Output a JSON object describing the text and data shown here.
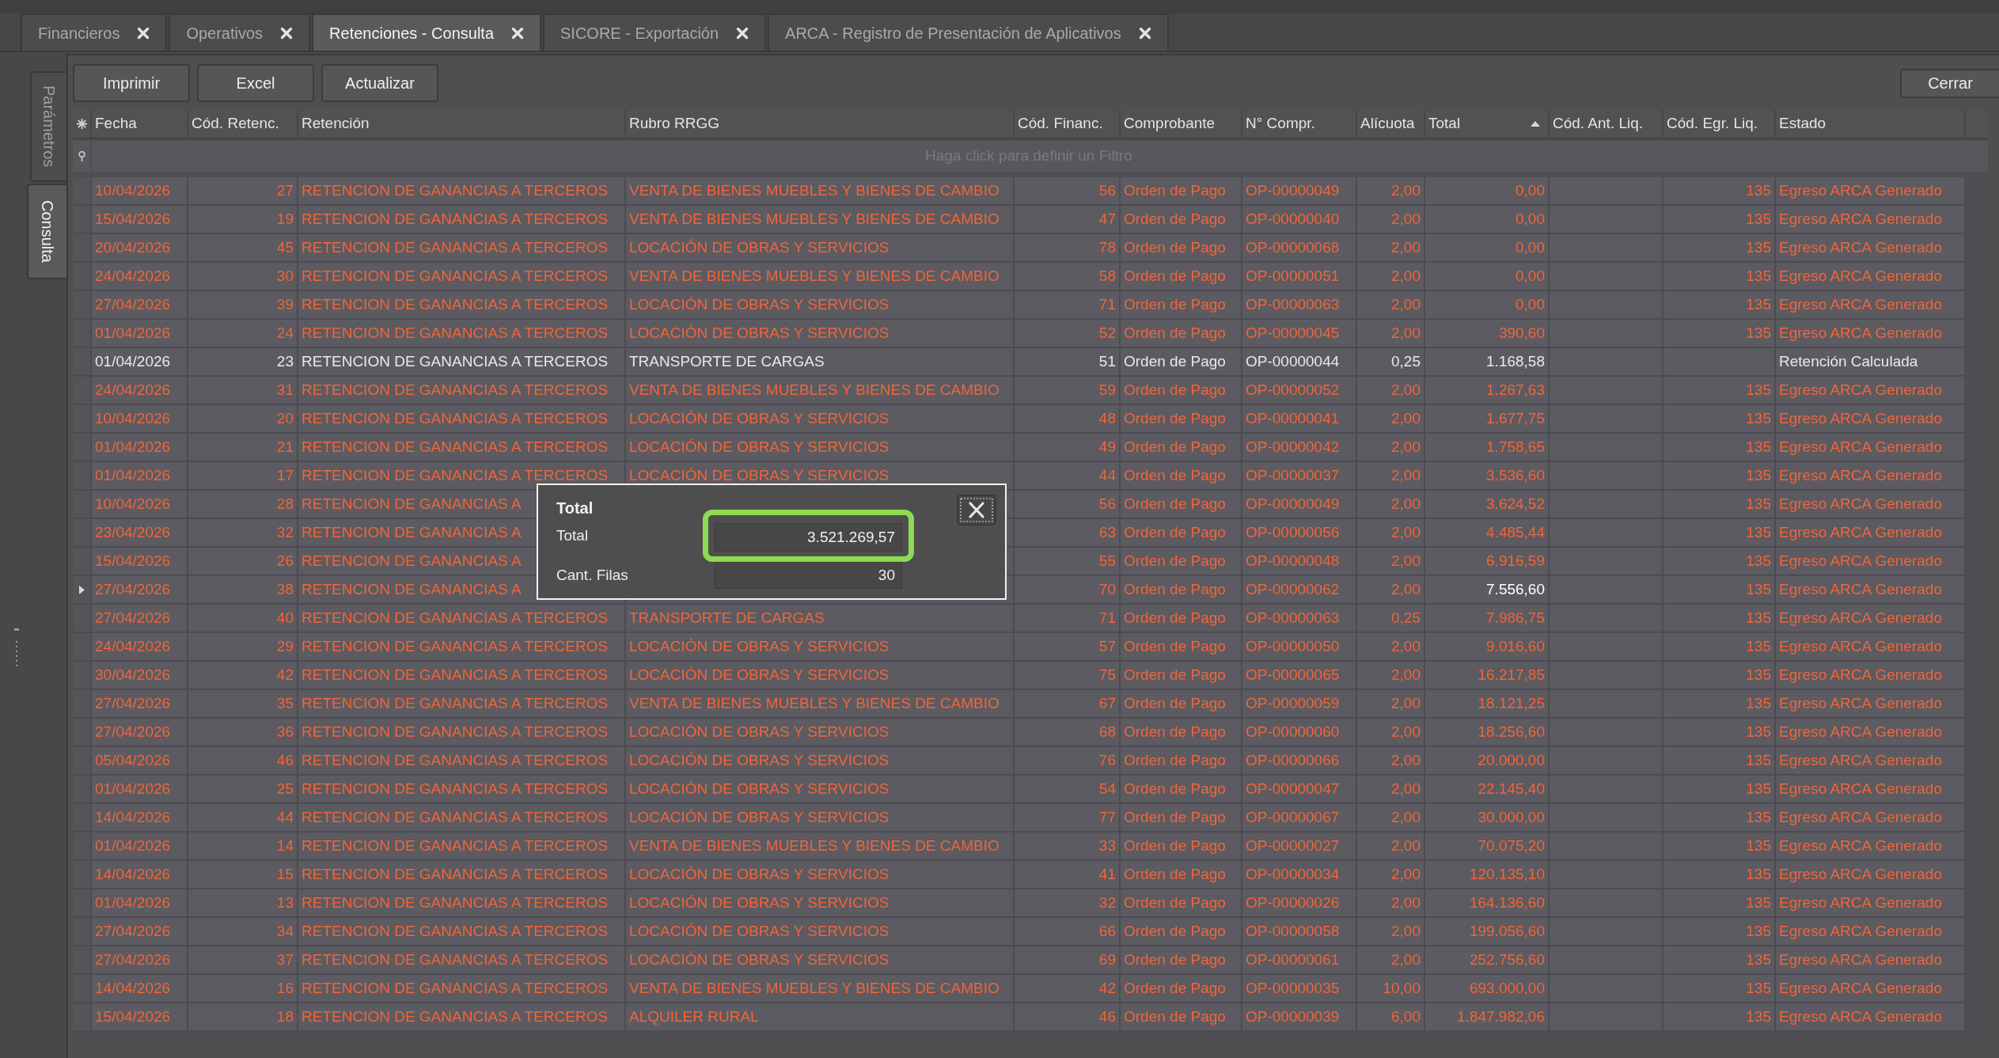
{
  "tabs": [
    {
      "label": "Financieros",
      "selected": false
    },
    {
      "label": "Operativos",
      "selected": false
    },
    {
      "label": "Retenciones - Consulta",
      "selected": true
    },
    {
      "label": "SICORE - Exportación",
      "selected": false
    },
    {
      "label": "ARCA - Registro de Presentación de Aplicativos",
      "selected": false
    }
  ],
  "side_tabs": [
    {
      "label": "Parámetros",
      "selected": false
    },
    {
      "label": "Consulta",
      "selected": true
    }
  ],
  "toolbar": {
    "buttons": [
      "Imprimir",
      "Excel",
      "Actualizar"
    ],
    "close_button": "Cerrar"
  },
  "table": {
    "columns": [
      {
        "label": "Fecha",
        "sorted": false,
        "focused": false
      },
      {
        "label": "Cód. Retenc.",
        "sorted": false,
        "focused": false
      },
      {
        "label": "Retención",
        "sorted": false,
        "focused": false
      },
      {
        "label": "Rubro RRGG",
        "sorted": false
      },
      {
        "label": "Cód. Financ.",
        "sorted": false,
        "focused": false
      },
      {
        "label": "Comprobante",
        "sorted": false,
        "focused": false
      },
      {
        "label": "N° Compr.",
        "sorted": false,
        "focused": false
      },
      {
        "label": "Alícuota",
        "sorted": false,
        "focused": false
      },
      {
        "label": "Total",
        "sorted": true,
        "focused": true
      },
      {
        "label": "Cód. Ant. Liq.",
        "sorted": false
      },
      {
        "label": "Cód. Egr. Liq.",
        "sorted": false,
        "focused": false
      },
      {
        "label": "Estado",
        "sorted": false,
        "focused": false
      }
    ],
    "filter_row": {
      "placeholder": "Haga click para definir un Filtro"
    },
    "rows": [
      {
        "selected": false,
        "color": "#f0653a",
        "fecha": "10/04/2026",
        "cod_retenc": "27",
        "retencion": "RETENCION DE GANANCIAS A TERCEROS",
        "rubro_rrgg": "VENTA DE BIENES MUEBLES Y BIENES DE CAMBIO",
        "cod_financ": "56",
        "comprobante": "Orden de Pago",
        "n_compr": "OP-00000049",
        "alicuota": "2,00",
        "total": "0,00",
        "cod_egr_liq": "135",
        "estado": "Egreso ARCA Generado"
      },
      {
        "selected": false,
        "color": "#f0653a",
        "fecha": "15/04/2026",
        "cod_retenc": "19",
        "retencion": "RETENCION DE GANANCIAS A TERCEROS",
        "rubro_rrgg": "VENTA DE BIENES MUEBLES Y BIENES DE CAMBIO",
        "cod_financ": "47",
        "comprobante": "Orden de Pago",
        "n_compr": "OP-00000040",
        "alicuota": "2,00",
        "total": "0,00",
        "cod_egr_liq": "135",
        "estado": "Egreso ARCA Generado"
      },
      {
        "selected": false,
        "color": "#f0653a",
        "fecha": "20/04/2026",
        "cod_retenc": "45",
        "retencion": "RETENCION DE GANANCIAS A TERCEROS",
        "rubro_rrgg": "LOCACIÓN DE OBRAS Y SERVICIOS",
        "cod_financ": "78",
        "comprobante": "Orden de Pago",
        "n_compr": "OP-00000068",
        "alicuota": "2,00",
        "total": "0,00",
        "cod_egr_liq": "135",
        "estado": "Egreso ARCA Generado"
      },
      {
        "selected": false,
        "color": "#f0653a",
        "fecha": "24/04/2026",
        "cod_retenc": "30",
        "retencion": "RETENCION DE GANANCIAS A TERCEROS",
        "rubro_rrgg": "VENTA DE BIENES MUEBLES Y BIENES DE CAMBIO",
        "cod_financ": "58",
        "comprobante": "Orden de Pago",
        "n_compr": "OP-00000051",
        "alicuota": "2,00",
        "total": "0,00",
        "cod_egr_liq": "135",
        "estado": "Egreso ARCA Generado"
      },
      {
        "selected": false,
        "color": "#f0653a",
        "fecha": "27/04/2026",
        "cod_retenc": "39",
        "retencion": "RETENCION DE GANANCIAS A TERCEROS",
        "rubro_rrgg": "LOCACIÓN DE OBRAS Y SERVICIOS",
        "cod_financ": "71",
        "comprobante": "Orden de Pago",
        "n_compr": "OP-00000063",
        "alicuota": "2,00",
        "total": "0,00",
        "cod_egr_liq": "135",
        "estado": "Egreso ARCA Generado"
      },
      {
        "selected": false,
        "color": "#f0653a",
        "fecha": "01/04/2026",
        "cod_retenc": "24",
        "retencion": "RETENCION DE GANANCIAS A TERCEROS",
        "rubro_rrgg": "LOCACIÓN DE OBRAS Y SERVICIOS",
        "cod_financ": "52",
        "comprobante": "Orden de Pago",
        "n_compr": "OP-00000045",
        "alicuota": "2,00",
        "total": "390,60",
        "cod_egr_liq": "135",
        "estado": "Egreso ARCA Generado"
      },
      {
        "selected": false,
        "color": "#e8e8e8",
        "fecha": "01/04/2026",
        "cod_retenc": "23",
        "retencion": "RETENCION DE GANANCIAS A TERCEROS",
        "rubro_rrgg": "TRANSPORTE DE CARGAS",
        "cod_financ": "51",
        "comprobante": "Orden de Pago",
        "n_compr": "OP-00000044",
        "alicuota": "0,25",
        "total": "1.168,58",
        "estado": "Retención Calculada"
      },
      {
        "selected": false,
        "color": "#f0653a",
        "fecha": "24/04/2026",
        "cod_retenc": "31",
        "retencion": "RETENCION DE GANANCIAS A TERCEROS",
        "rubro_rrgg": "VENTA DE BIENES MUEBLES Y BIENES DE CAMBIO",
        "cod_financ": "59",
        "comprobante": "Orden de Pago",
        "n_compr": "OP-00000052",
        "alicuota": "2,00",
        "total": "1.267,63",
        "cod_egr_liq": "135",
        "estado": "Egreso ARCA Generado"
      },
      {
        "selected": false,
        "color": "#f0653a",
        "fecha": "10/04/2026",
        "cod_retenc": "20",
        "retencion": "RETENCION DE GANANCIAS A TERCEROS",
        "rubro_rrgg": "LOCACIÓN DE OBRAS Y SERVICIOS",
        "cod_financ": "48",
        "comprobante": "Orden de Pago",
        "n_compr": "OP-00000041",
        "alicuota": "2,00",
        "total": "1.677,75",
        "cod_egr_liq": "135",
        "estado": "Egreso ARCA Generado"
      },
      {
        "selected": false,
        "color": "#f0653a",
        "fecha": "01/04/2026",
        "cod_retenc": "21",
        "retencion": "RETENCION DE GANANCIAS A TERCEROS",
        "rubro_rrgg": "LOCACIÓN DE OBRAS Y SERVICIOS",
        "cod_financ": "49",
        "comprobante": "Orden de Pago",
        "n_compr": "OP-00000042",
        "alicuota": "2,00",
        "total": "1.758,65",
        "cod_egr_liq": "135",
        "estado": "Egreso ARCA Generado"
      },
      {
        "selected": false,
        "color": "#f0653a",
        "fecha": "01/04/2026",
        "cod_retenc": "17",
        "retencion": "RETENCION DE GANANCIAS A TERCEROS",
        "rubro_rrgg": "LOCACIÓN DE OBRAS Y SERVICIOS",
        "cod_financ": "44",
        "comprobante": "Orden de Pago",
        "n_compr": "OP-00000037",
        "alicuota": "2,00",
        "total": "3.536,60",
        "cod_egr_liq": "135",
        "estado": "Egreso ARCA Generado"
      },
      {
        "selected": false,
        "color": "#f0653a",
        "fecha": "10/04/2026",
        "cod_retenc": "28",
        "retencion": "RETENCION DE GANANCIAS A",
        "cod_financ": "56",
        "comprobante": "Orden de Pago",
        "n_compr": "OP-00000049",
        "alicuota": "2,00",
        "total": "3.624,52",
        "cod_egr_liq": "135",
        "estado": "Egreso ARCA Generado"
      },
      {
        "selected": false,
        "color": "#f0653a",
        "fecha": "23/04/2026",
        "cod_retenc": "32",
        "retencion": "RETENCION DE GANANCIAS A",
        "cod_financ": "63",
        "comprobante": "Orden de Pago",
        "n_compr": "OP-00000056",
        "alicuota": "2,00",
        "total": "4.485,44",
        "cod_egr_liq": "135",
        "estado": "Egreso ARCA Generado"
      },
      {
        "selected": false,
        "color": "#f0653a",
        "fecha": "15/04/2026",
        "cod_retenc": "26",
        "retencion": "RETENCION DE GANANCIAS A",
        "cod_financ": "55",
        "comprobante": "Orden de Pago",
        "n_compr": "OP-00000048",
        "alicuota": "2,00",
        "total": "6.916,59",
        "cod_egr_liq": "135",
        "estado": "Egreso ARCA Generado"
      },
      {
        "selected": true,
        "color": "#f0653a",
        "fecha": "27/04/2026",
        "cod_retenc": "38",
        "retencion": "RETENCION DE GANANCIAS A",
        "cod_financ": "70",
        "comprobante": "Orden de Pago",
        "n_compr": "OP-00000062",
        "alicuota": "2,00",
        "total": "7.556,60",
        "cod_egr_liq": "135",
        "estado": "Egreso ARCA Generado"
      },
      {
        "selected": false,
        "color": "#f0653a",
        "fecha": "27/04/2026",
        "cod_retenc": "40",
        "retencion": "RETENCION DE GANANCIAS A TERCEROS",
        "rubro_rrgg": "TRANSPORTE DE CARGAS",
        "cod_financ": "71",
        "comprobante": "Orden de Pago",
        "n_compr": "OP-00000063",
        "alicuota": "0,25",
        "total": "7.986,75",
        "cod_egr_liq": "135",
        "estado": "Egreso ARCA Generado"
      },
      {
        "selected": false,
        "color": "#f0653a",
        "fecha": "24/04/2026",
        "cod_retenc": "29",
        "retencion": "RETENCION DE GANANCIAS A TERCEROS",
        "rubro_rrgg": "LOCACIÓN DE OBRAS Y SERVICIOS",
        "cod_financ": "57",
        "comprobante": "Orden de Pago",
        "n_compr": "OP-00000050",
        "alicuota": "2,00",
        "total": "9.016,60",
        "cod_egr_liq": "135",
        "estado": "Egreso ARCA Generado"
      },
      {
        "selected": false,
        "color": "#f0653a",
        "fecha": "30/04/2026",
        "cod_retenc": "42",
        "retencion": "RETENCION DE GANANCIAS A TERCEROS",
        "rubro_rrgg": "LOCACIÓN DE OBRAS Y SERVICIOS",
        "cod_financ": "75",
        "comprobante": "Orden de Pago",
        "n_compr": "OP-00000065",
        "alicuota": "2,00",
        "total": "16.217,85",
        "cod_egr_liq": "135",
        "estado": "Egreso ARCA Generado"
      },
      {
        "selected": false,
        "color": "#f0653a",
        "fecha": "27/04/2026",
        "cod_retenc": "35",
        "retencion": "RETENCION DE GANANCIAS A TERCEROS",
        "rubro_rrgg": "VENTA DE BIENES MUEBLES Y BIENES DE CAMBIO",
        "cod_financ": "67",
        "comprobante": "Orden de Pago",
        "n_compr": "OP-00000059",
        "alicuota": "2,00",
        "total": "18.121,25",
        "cod_egr_liq": "135",
        "estado": "Egreso ARCA Generado"
      },
      {
        "selected": false,
        "color": "#f0653a",
        "fecha": "27/04/2026",
        "cod_retenc": "36",
        "retencion": "RETENCION DE GANANCIAS A TERCEROS",
        "rubro_rrgg": "LOCACIÓN DE OBRAS Y SERVICIOS",
        "cod_financ": "68",
        "comprobante": "Orden de Pago",
        "n_compr": "OP-00000060",
        "alicuota": "2,00",
        "total": "18.256,60",
        "cod_egr_liq": "135",
        "estado": "Egreso ARCA Generado"
      },
      {
        "selected": false,
        "color": "#f0653a",
        "fecha": "05/04/2026",
        "cod_retenc": "46",
        "retencion": "RETENCION DE GANANCIAS A TERCEROS",
        "rubro_rrgg": "LOCACIÓN DE OBRAS Y SERVICIOS",
        "cod_financ": "76",
        "comprobante": "Orden de Pago",
        "n_compr": "OP-00000066",
        "alicuota": "2,00",
        "total": "20.000,00",
        "cod_egr_liq": "135",
        "estado": "Egreso ARCA Generado"
      },
      {
        "selected": false,
        "color": "#f0653a",
        "fecha": "01/04/2026",
        "cod_retenc": "25",
        "retencion": "RETENCION DE GANANCIAS A TERCEROS",
        "rubro_rrgg": "LOCACIÓN DE OBRAS Y SERVICIOS",
        "cod_financ": "54",
        "comprobante": "Orden de Pago",
        "n_compr": "OP-00000047",
        "alicuota": "2,00",
        "total": "22.145,40",
        "cod_egr_liq": "135",
        "estado": "Egreso ARCA Generado"
      },
      {
        "selected": false,
        "color": "#f0653a",
        "fecha": "14/04/2026",
        "cod_retenc": "44",
        "retencion": "RETENCION DE GANANCIAS A TERCEROS",
        "rubro_rrgg": "LOCACIÓN DE OBRAS Y SERVICIOS",
        "cod_financ": "77",
        "comprobante": "Orden de Pago",
        "n_compr": "OP-00000067",
        "alicuota": "2,00",
        "total": "30.000,00",
        "cod_egr_liq": "135",
        "estado": "Egreso ARCA Generado"
      },
      {
        "selected": false,
        "color": "#f0653a",
        "fecha": "01/04/2026",
        "cod_retenc": "14",
        "retencion": "RETENCION DE GANANCIAS A TERCEROS",
        "rubro_rrgg": "VENTA DE BIENES MUEBLES Y BIENES DE CAMBIO",
        "cod_financ": "33",
        "comprobante": "Orden de Pago",
        "n_compr": "OP-00000027",
        "alicuota": "2,00",
        "total": "70.075,20",
        "cod_egr_liq": "135",
        "estado": "Egreso ARCA Generado"
      },
      {
        "selected": false,
        "color": "#f0653a",
        "fecha": "14/04/2026",
        "cod_retenc": "15",
        "retencion": "RETENCION DE GANANCIAS A TERCEROS",
        "rubro_rrgg": "LOCACIÓN DE OBRAS Y SERVICIOS",
        "cod_financ": "41",
        "comprobante": "Orden de Pago",
        "n_compr": "OP-00000034",
        "alicuota": "2,00",
        "total": "120.135,10",
        "cod_egr_liq": "135",
        "estado": "Egreso ARCA Generado"
      },
      {
        "selected": false,
        "color": "#f0653a",
        "fecha": "01/04/2026",
        "cod_retenc": "13",
        "retencion": "RETENCION DE GANANCIAS A TERCEROS",
        "rubro_rrgg": "LOCACIÓN DE OBRAS Y SERVICIOS",
        "cod_financ": "32",
        "comprobante": "Orden de Pago",
        "n_compr": "OP-00000026",
        "alicuota": "2,00",
        "total": "164.136,60",
        "cod_egr_liq": "135",
        "estado": "Egreso ARCA Generado"
      },
      {
        "selected": false,
        "color": "#f0653a",
        "fecha": "27/04/2026",
        "cod_retenc": "34",
        "retencion": "RETENCION DE GANANCIAS A TERCEROS",
        "rubro_rrgg": "LOCACIÓN DE OBRAS Y SERVICIOS",
        "cod_financ": "66",
        "comprobante": "Orden de Pago",
        "n_compr": "OP-00000058",
        "alicuota": "2,00",
        "total": "199.056,60",
        "cod_egr_liq": "135",
        "estado": "Egreso ARCA Generado"
      },
      {
        "selected": false,
        "color": "#f0653a",
        "fecha": "27/04/2026",
        "cod_retenc": "37",
        "retencion": "RETENCION DE GANANCIAS A TERCEROS",
        "rubro_rrgg": "LOCACIÓN DE OBRAS Y SERVICIOS",
        "cod_financ": "69",
        "comprobante": "Orden de Pago",
        "n_compr": "OP-00000061",
        "alicuota": "2,00",
        "total": "252.756,60",
        "cod_egr_liq": "135",
        "estado": "Egreso ARCA Generado"
      },
      {
        "selected": false,
        "color": "#f0653a",
        "fecha": "14/04/2026",
        "cod_retenc": "16",
        "retencion": "RETENCION DE GANANCIAS A TERCEROS",
        "rubro_rrgg": "VENTA DE BIENES MUEBLES Y BIENES DE CAMBIO",
        "cod_financ": "42",
        "comprobante": "Orden de Pago",
        "n_compr": "OP-00000035",
        "alicuota": "10,00",
        "total": "693.000,00",
        "cod_egr_liq": "135",
        "estado": "Egreso ARCA Generado"
      },
      {
        "selected": false,
        "color": "#f0653a",
        "fecha": "15/04/2026",
        "cod_retenc": "18",
        "retencion": "RETENCION DE GANANCIAS A TERCEROS",
        "rubro_rrgg": "ALQUILER RURAL",
        "cod_financ": "46",
        "comprobante": "Orden de Pago",
        "n_compr": "OP-00000039",
        "alicuota": "6,00",
        "total": "1.847.982,06",
        "cod_egr_liq": "135",
        "estado": "Egreso ARCA Generado"
      }
    ]
  },
  "popup": {
    "title": "Total",
    "fields": [
      {
        "label": "Total",
        "value": "3.521.269,57",
        "highlighted": true
      },
      {
        "label": "Cant. Filas",
        "value": "30",
        "highlighted": false
      }
    ]
  }
}
